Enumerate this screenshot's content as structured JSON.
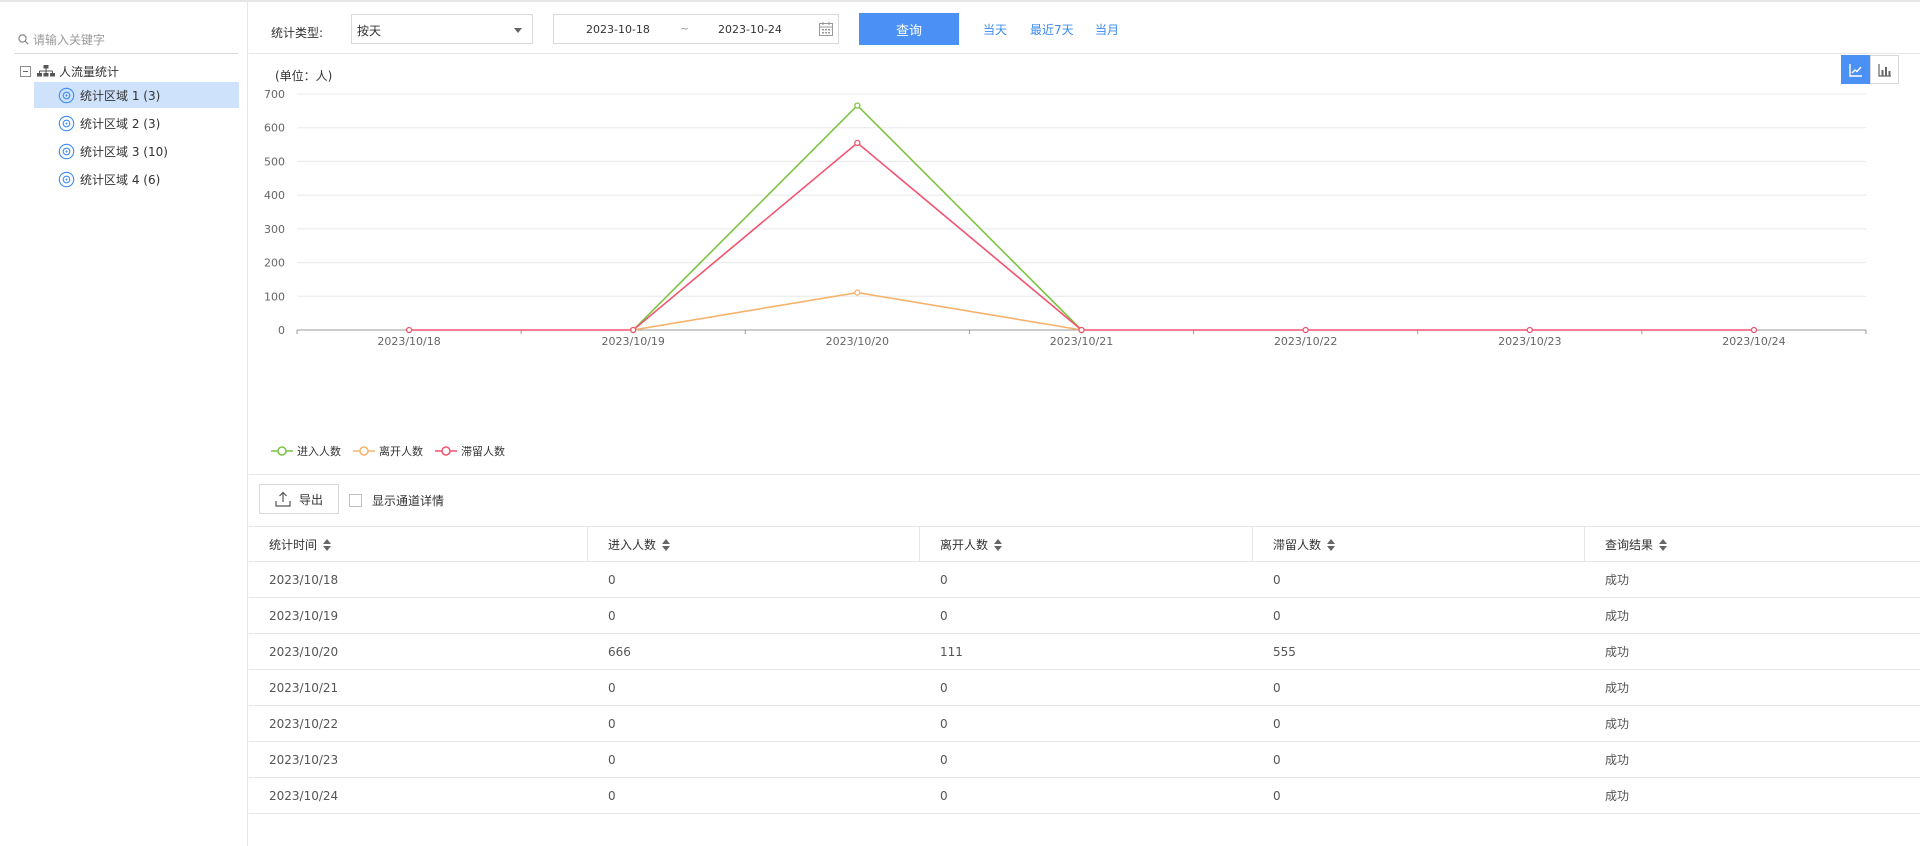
{
  "sidebar": {
    "search_placeholder": "请输入关键字",
    "root_label": "人流量统计",
    "items": [
      {
        "label": "统计区域 1 (3)",
        "selected": true
      },
      {
        "label": "统计区域 2 (3)",
        "selected": false
      },
      {
        "label": "统计区域 3 (10)",
        "selected": false
      },
      {
        "label": "统计区域 4 (6)",
        "selected": false
      }
    ]
  },
  "toolbar": {
    "stat_type_label": "统计类型:",
    "stat_type_value": "按天",
    "start_date": "2023-10-18",
    "date_separator": "~",
    "end_date": "2023-10-24",
    "query_label": "查询",
    "quick_today": "当天",
    "quick_7days": "最近7天",
    "quick_month": "当月"
  },
  "chart": {
    "unit_label": "(单位：人)",
    "active_view": "line",
    "colors": {
      "enter": "#7cc442",
      "leave": "#f7b26d",
      "stay": "#f2546f",
      "axis": "#999999",
      "grid": "#e8e8e8"
    }
  },
  "chart_data": {
    "type": "line",
    "title": "",
    "xlabel": "",
    "ylabel": "(单位：人)",
    "x": [
      "2023/10/18",
      "2023/10/19",
      "2023/10/20",
      "2023/10/21",
      "2023/10/22",
      "2023/10/23",
      "2023/10/24"
    ],
    "yticks": [
      "0",
      "100",
      "200",
      "300",
      "400",
      "500",
      "600",
      "700"
    ],
    "ylim": [
      0,
      700
    ],
    "grid": true,
    "legend_position": "bottom-left",
    "series": [
      {
        "name": "进入人数",
        "color": "#7cc442",
        "values": [
          null,
          0,
          666,
          0,
          null,
          null,
          null
        ]
      },
      {
        "name": "离开人数",
        "color": "#f7b26d",
        "values": [
          null,
          0,
          111,
          0,
          null,
          null,
          null
        ]
      },
      {
        "name": "滞留人数",
        "color": "#f2546f",
        "values": [
          0,
          0,
          555,
          0,
          0,
          0,
          0
        ]
      }
    ]
  },
  "table_tools": {
    "export_label": "导出",
    "show_channel_label": "显示通道详情"
  },
  "table": {
    "columns": [
      "统计时间",
      "进入人数",
      "离开人数",
      "滞留人数",
      "查询结果"
    ],
    "rows": [
      [
        "2023/10/18",
        "0",
        "0",
        "0",
        "成功"
      ],
      [
        "2023/10/19",
        "0",
        "0",
        "0",
        "成功"
      ],
      [
        "2023/10/20",
        "666",
        "111",
        "555",
        "成功"
      ],
      [
        "2023/10/21",
        "0",
        "0",
        "0",
        "成功"
      ],
      [
        "2023/10/22",
        "0",
        "0",
        "0",
        "成功"
      ],
      [
        "2023/10/23",
        "0",
        "0",
        "0",
        "成功"
      ],
      [
        "2023/10/24",
        "0",
        "0",
        "0",
        "成功"
      ]
    ]
  }
}
